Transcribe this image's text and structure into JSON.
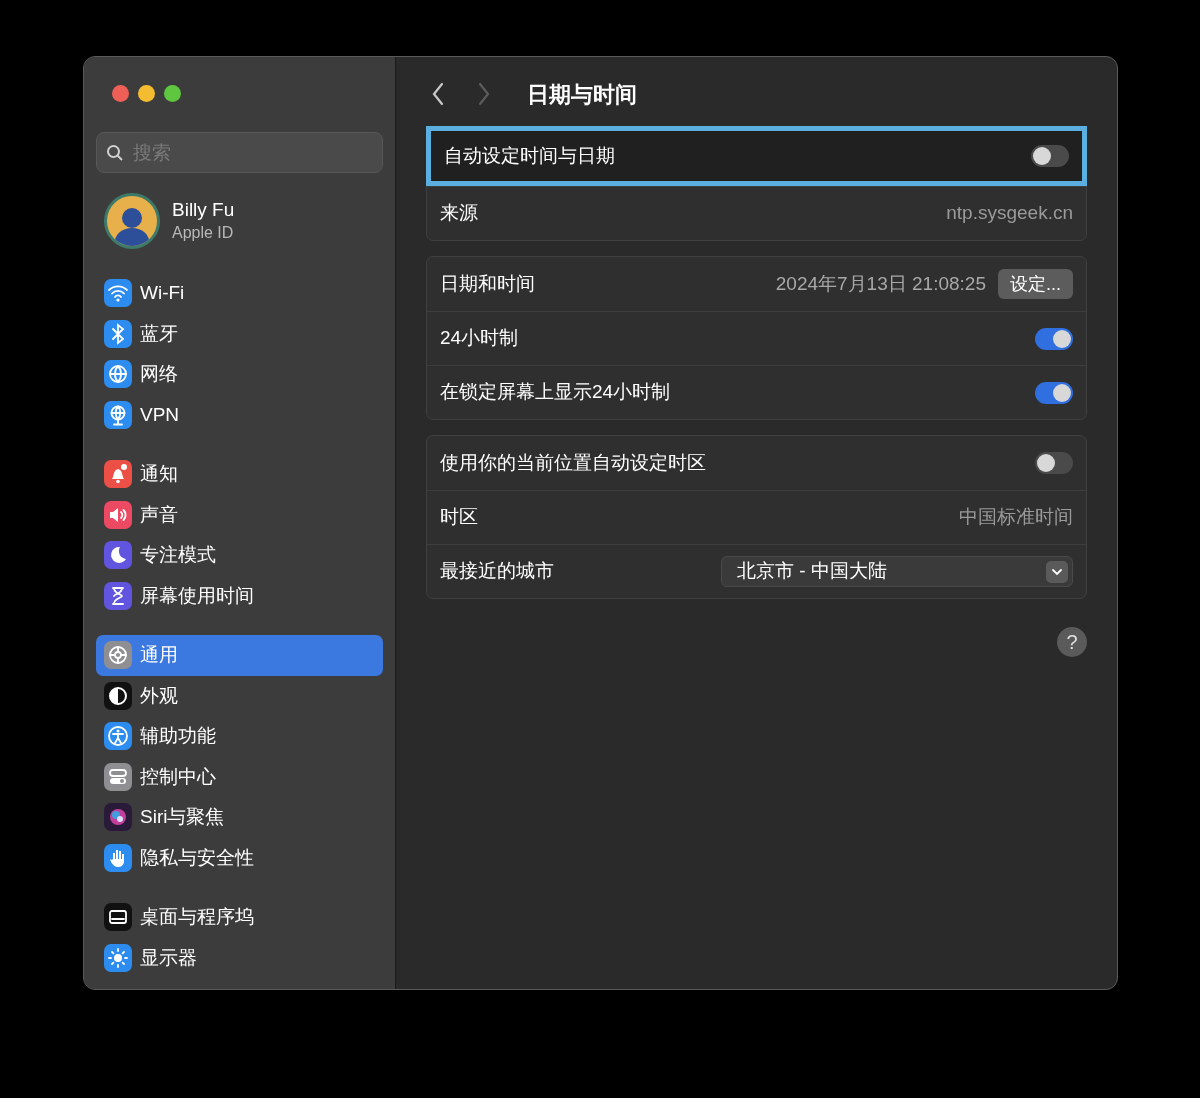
{
  "window": {
    "title": "日期与时间"
  },
  "sidebar": {
    "search": {
      "placeholder": "搜索"
    },
    "account": {
      "name": "Billy Fu",
      "subtitle": "Apple ID"
    },
    "groups": [
      [
        {
          "label": "Wi-Fi",
          "kind": "wifi",
          "selected": false
        },
        {
          "label": "蓝牙",
          "kind": "bluetooth",
          "selected": false
        },
        {
          "label": "网络",
          "kind": "globe",
          "selected": false
        },
        {
          "label": "VPN",
          "kind": "vpn",
          "selected": false
        }
      ],
      [
        {
          "label": "通知",
          "kind": "bell",
          "selected": false
        },
        {
          "label": "声音",
          "kind": "speaker",
          "selected": false
        },
        {
          "label": "专注模式",
          "kind": "moon",
          "selected": false
        },
        {
          "label": "屏幕使用时间",
          "kind": "hourglass",
          "selected": false
        }
      ],
      [
        {
          "label": "通用",
          "kind": "gear",
          "selected": true
        },
        {
          "label": "外观",
          "kind": "appearance",
          "selected": false
        },
        {
          "label": "辅助功能",
          "kind": "accessibility",
          "selected": false
        },
        {
          "label": "控制中心",
          "kind": "switches",
          "selected": false
        },
        {
          "label": "Siri与聚焦",
          "kind": "siri",
          "selected": false
        },
        {
          "label": "隐私与安全性",
          "kind": "hand",
          "selected": false
        }
      ],
      [
        {
          "label": "桌面与程序坞",
          "kind": "dock",
          "selected": false
        },
        {
          "label": "显示器",
          "kind": "sun",
          "selected": false
        }
      ]
    ]
  },
  "groups": [
    [
      {
        "kind": "toggle",
        "label": "自动设定时间与日期",
        "on": false,
        "highlighted": true
      },
      {
        "kind": "value",
        "label": "来源",
        "value": "ntp.sysgeek.cn",
        "highlighted": false
      }
    ],
    [
      {
        "kind": "datetime",
        "label": "日期和时间",
        "value": "2024年7月13日 21:08:25",
        "button": "设定...",
        "highlighted": false
      },
      {
        "kind": "toggle",
        "label": "24小时制",
        "on": true,
        "highlighted": false
      },
      {
        "kind": "toggle",
        "label": "在锁定屏幕上显示24小时制",
        "on": true,
        "highlighted": false
      }
    ],
    [
      {
        "kind": "toggle",
        "label": "使用你的当前位置自动设定时区",
        "on": false,
        "highlighted": false
      },
      {
        "kind": "value",
        "label": "时区",
        "value": "中国标准时间",
        "highlighted": false
      },
      {
        "kind": "popup",
        "label": "最接近的城市",
        "value": "北京市 - 中国大陆",
        "highlighted": false
      }
    ]
  ],
  "help_button": "?"
}
